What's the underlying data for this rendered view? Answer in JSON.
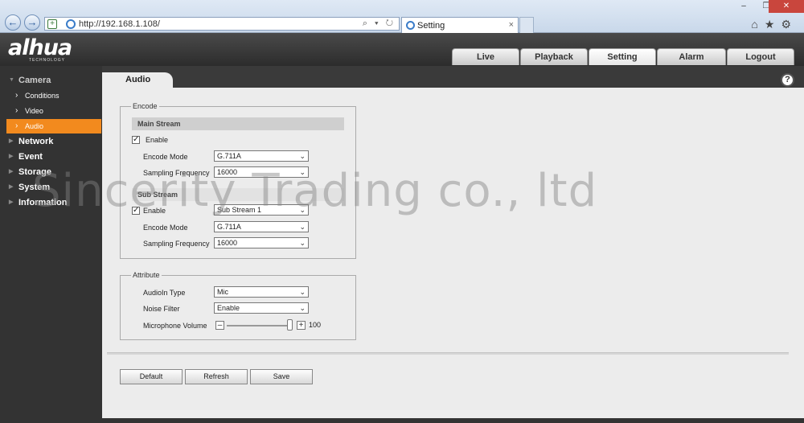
{
  "browser": {
    "address_url": "http://192.168.1.108/",
    "address_controls": "⌕ ▾ ↻",
    "tab_title": "Setting",
    "tab_close": "×",
    "window_controls": [
      "–",
      "❐",
      "✕"
    ],
    "toolbar_icons": [
      "home-icon",
      "star-icon",
      "gear-icon"
    ]
  },
  "header": {
    "logo": "alhua",
    "logo_sub": "TECHNOLOGY",
    "nav": [
      "Live",
      "Playback",
      "Setting",
      "Alarm",
      "Logout"
    ],
    "active_nav": "Setting"
  },
  "sidebar": {
    "camera": "Camera",
    "sub_items": [
      "Conditions",
      "Video",
      "Audio"
    ],
    "active_sub": "Audio",
    "sections": [
      "Network",
      "Event",
      "Storage",
      "System",
      "Information"
    ]
  },
  "content": {
    "tab": "Audio",
    "help": "?",
    "encode": {
      "legend": "Encode",
      "main_stream": {
        "heading": "Main Stream",
        "enable_label": "Enable",
        "enabled": true,
        "encode_mode_label": "Encode Mode",
        "encode_mode": "G.711A",
        "sampling_label": "Sampling Frequency",
        "sampling": "16000"
      },
      "sub_stream": {
        "heading": "Sub Stream",
        "enable_label": "Enable",
        "enabled": true,
        "stream_select": "Sub Stream 1",
        "encode_mode_label": "Encode Mode",
        "encode_mode": "G.711A",
        "sampling_label": "Sampling Frequency",
        "sampling": "16000"
      }
    },
    "attribute": {
      "legend": "Attribute",
      "audioin_label": "AudioIn Type",
      "audioin": "Mic",
      "noise_label": "Noise Filter",
      "noise": "Enable",
      "volume_label": "Microphone Volume",
      "volume": "100",
      "volume_level": 1.0
    },
    "buttons": {
      "default": "Default",
      "refresh": "Refresh",
      "save": "Save"
    }
  },
  "watermark": "Sincerity Trading co., ltd",
  "colors": {
    "accent": "#f28a1e",
    "sidebar_bg": "#333333",
    "content_bg": "#ececec"
  }
}
